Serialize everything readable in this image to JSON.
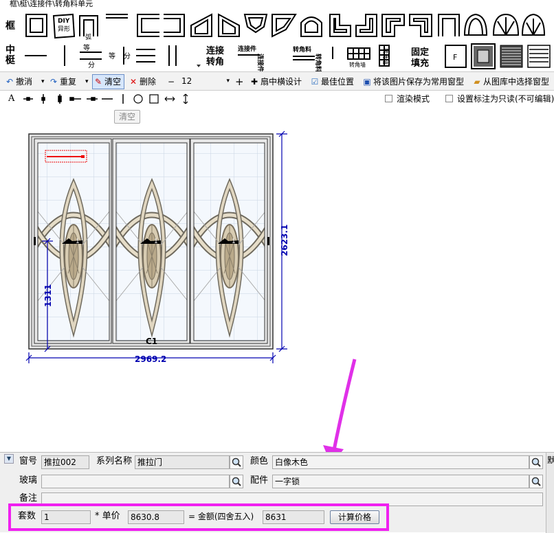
{
  "tab_path": "框\\梃\\连接件\\转角料单元",
  "row1_label": "框",
  "row2_label_top": "中",
  "row2_label_bottom": "梃",
  "tools": {
    "diy_top": "DIY",
    "diy_bottom": "异形",
    "arc_label": "弧",
    "equal_top": "等",
    "equal_bottom": "分",
    "equal_side_a": "等",
    "equal_side_b": "分",
    "connector_big_top": "连接",
    "connector_big_bottom": "转角",
    "connector_piece_h": "连接件",
    "connector_piece_v": "连接件",
    "corner_material_h": "转角料",
    "corner_material_v": "转角料",
    "corner_wall_h": "转角墙",
    "corner_wall_v": "转角墙",
    "fixed_fill_top": "固定",
    "fixed_fill_bottom": "填充",
    "fill_f": "F"
  },
  "toolbar": {
    "undo": "撤消",
    "redo": "重复",
    "clear": "清空",
    "delete": "删除",
    "minus": "−",
    "size_value": "12",
    "plus": "+",
    "sash_design": "扇中横设计",
    "best_position": "最佳位置",
    "save_as_common": "将该图片保存为常用窗型",
    "choose_from_library": "从图库中选择窗型"
  },
  "draw_toolbar": {
    "text_tool": "A",
    "render_mode": "渲染模式",
    "readonly_label": "设置标注为只读(不可编辑)"
  },
  "tooltip": "清空",
  "drawing": {
    "width_dim": "2969.2",
    "height_dim": "2623.1",
    "handle_height_dim": "1311",
    "window_code": "C1",
    "sash_mark": "1"
  },
  "form": {
    "window_no_label": "窗号",
    "window_no": "推拉002",
    "series_label": "系列名称",
    "series": "推拉门",
    "color_label": "颜色",
    "color": "白像木色",
    "glass_label": "玻璃",
    "glass": "",
    "fitting_label": "配件",
    "fitting": "一字锁",
    "remark_label": "备注",
    "remark": "",
    "sets_label": "套数",
    "sets": "1",
    "unit_price_label": "* 单价",
    "unit_price": "8630.8",
    "amount_label": "= 金额(四舍五入)",
    "amount": "8631",
    "calc_button": "计算价格",
    "right_edge": "默"
  },
  "colors": {
    "dimension_blue": "#0000b0",
    "highlight_magenta": "#f020f0",
    "arrow_magenta": "#e030e8"
  }
}
